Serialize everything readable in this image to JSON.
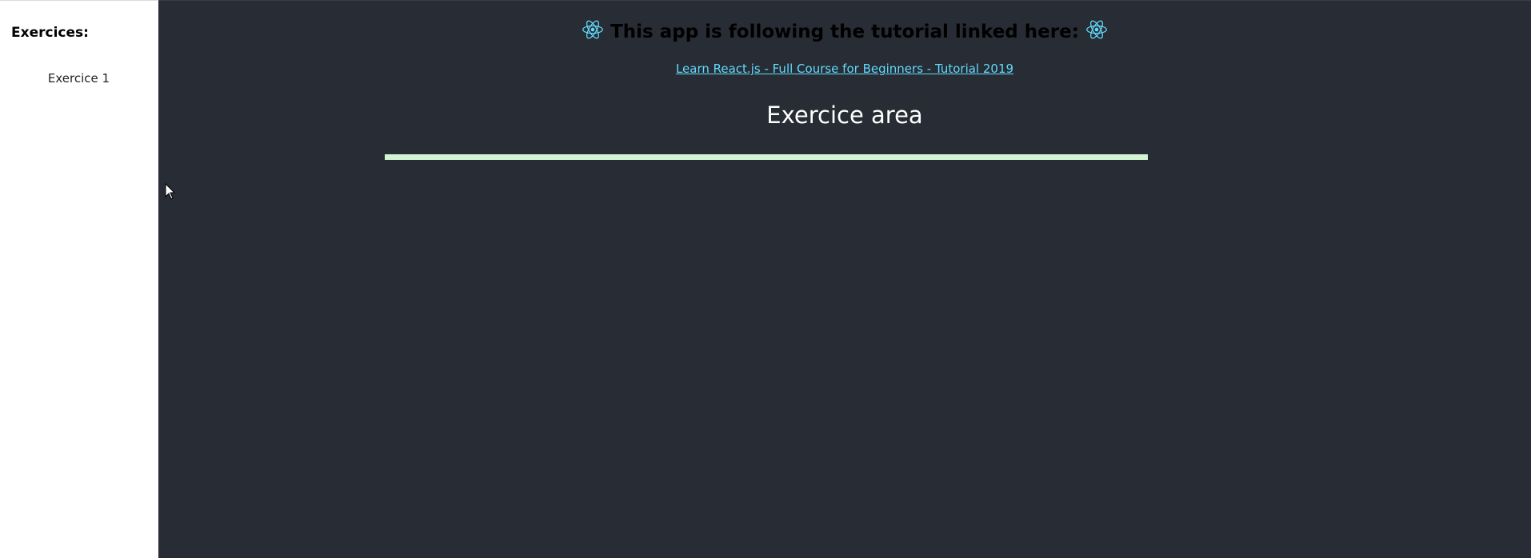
{
  "sidebar": {
    "title": "Exercices:",
    "items": [
      {
        "label": "Exercice 1"
      }
    ]
  },
  "header": {
    "title": "This app is following the tutorial linked here:",
    "icon": "react-atom-icon"
  },
  "link": {
    "text": "Learn React.js - Full Course for Beginners - Tutorial 2019"
  },
  "exercise_area": {
    "title": "Exercice area"
  },
  "colors": {
    "main_background": "#282c34",
    "sidebar_background": "#ffffff",
    "link": "#61dafb",
    "divider": "#d3f5d3",
    "react_blue": "#61dafb"
  }
}
